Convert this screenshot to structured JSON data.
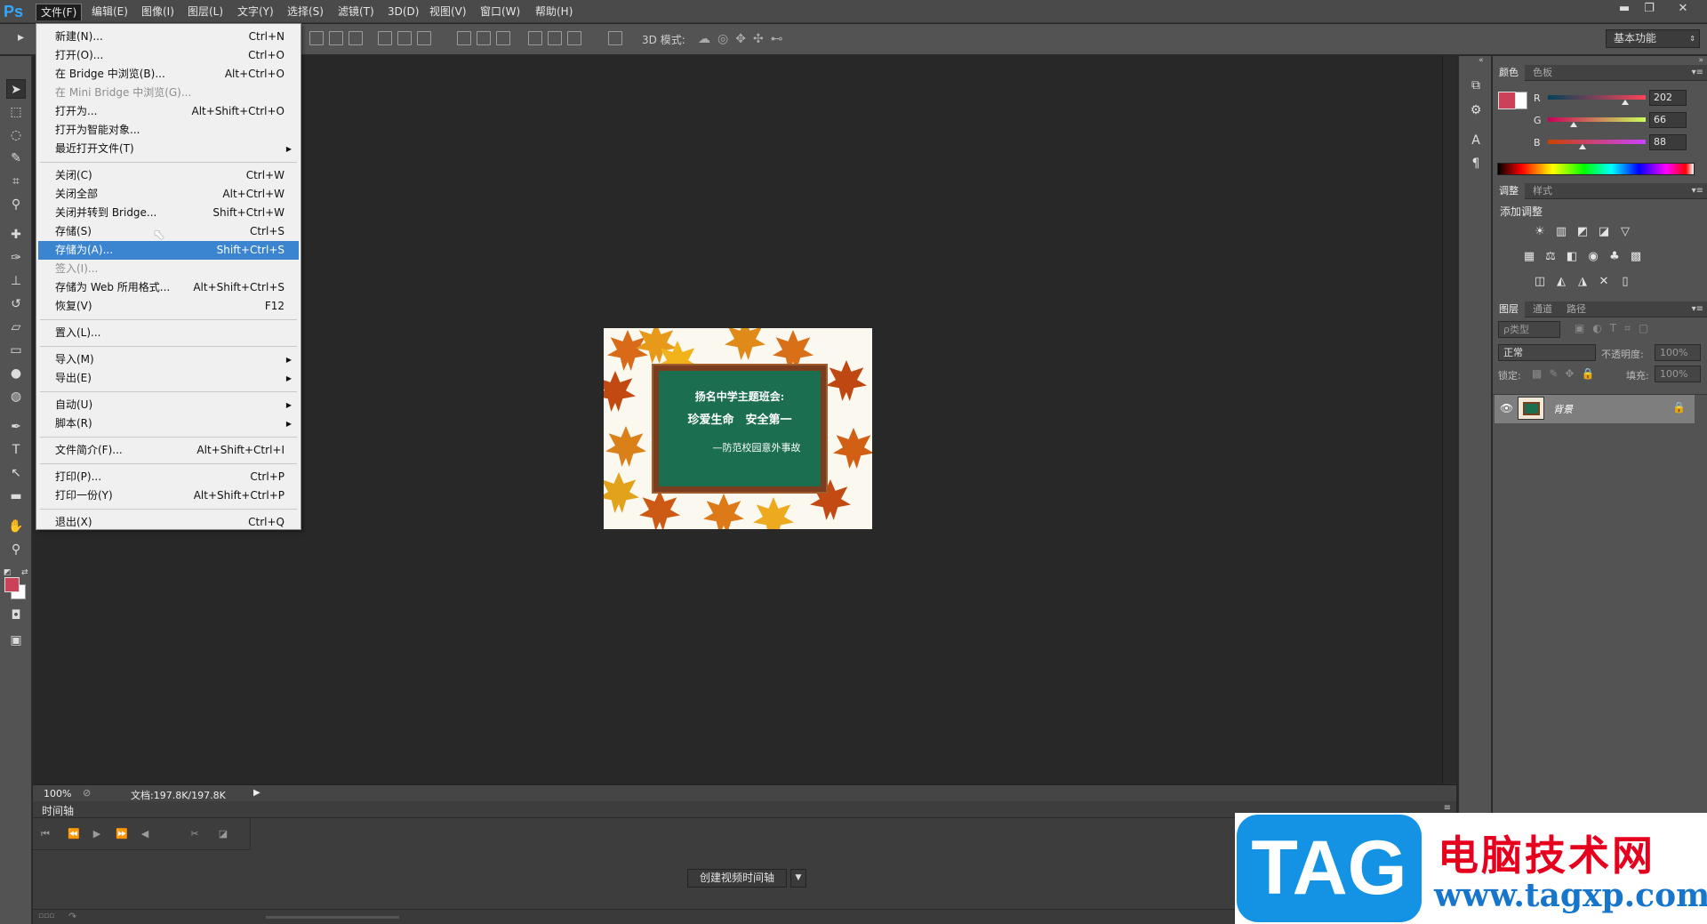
{
  "app": {
    "logo": "Ps",
    "workspace": "基本功能"
  },
  "menubar": [
    "文件(F)",
    "编辑(E)",
    "图像(I)",
    "图层(L)",
    "文字(Y)",
    "选择(S)",
    "滤镜(T)",
    "3D(D)",
    "视图(V)",
    "窗口(W)",
    "帮助(H)"
  ],
  "window_controls": {
    "minimize": "▬",
    "restore": "❐",
    "close": "✕"
  },
  "options_bar": {
    "mode_label": "3D 模式:"
  },
  "file_menu": [
    {
      "label": "新建(N)...",
      "shortcut": "Ctrl+N"
    },
    {
      "label": "打开(O)...",
      "shortcut": "Ctrl+O"
    },
    {
      "label": "在 Bridge 中浏览(B)...",
      "shortcut": "Alt+Ctrl+O"
    },
    {
      "label": "在 Mini Bridge 中浏览(G)...",
      "shortcut": "",
      "disabled": true
    },
    {
      "label": "打开为...",
      "shortcut": "Alt+Shift+Ctrl+O"
    },
    {
      "label": "打开为智能对象...",
      "shortcut": ""
    },
    {
      "label": "最近打开文件(T)",
      "shortcut": "",
      "submenu": true
    },
    {
      "label": "关闭(C)",
      "shortcut": "Ctrl+W"
    },
    {
      "label": "关闭全部",
      "shortcut": "Alt+Ctrl+W"
    },
    {
      "label": "关闭并转到 Bridge...",
      "shortcut": "Shift+Ctrl+W"
    },
    {
      "label": "存储(S)",
      "shortcut": "Ctrl+S"
    },
    {
      "label": "存储为(A)...",
      "shortcut": "Shift+Ctrl+S",
      "highlighted": true
    },
    {
      "label": "签入(I)...",
      "shortcut": "",
      "disabled": true
    },
    {
      "label": "存储为 Web 所用格式...",
      "shortcut": "Alt+Shift+Ctrl+S"
    },
    {
      "label": "恢复(V)",
      "shortcut": "F12"
    },
    {
      "label": "置入(L)...",
      "shortcut": ""
    },
    {
      "label": "导入(M)",
      "shortcut": "",
      "submenu": true
    },
    {
      "label": "导出(E)",
      "shortcut": "",
      "submenu": true
    },
    {
      "label": "自动(U)",
      "shortcut": "",
      "submenu": true
    },
    {
      "label": "脚本(R)",
      "shortcut": "",
      "submenu": true
    },
    {
      "label": "文件简介(F)...",
      "shortcut": "Alt+Shift+Ctrl+I"
    },
    {
      "label": "打印(P)...",
      "shortcut": "Ctrl+P"
    },
    {
      "label": "打印一份(Y)",
      "shortcut": "Alt+Shift+Ctrl+P"
    },
    {
      "label": "退出(X)",
      "shortcut": "Ctrl+Q"
    }
  ],
  "document": {
    "line1": "扬名中学主题班会:",
    "line2": "珍爱生命　安全第一",
    "line3": "—防范校园意外事故"
  },
  "status": {
    "zoom": "100%",
    "doc_info": "文档:197.8K/197.8K"
  },
  "timeline": {
    "tab": "时间轴",
    "create_button": "创建视频时间轴"
  },
  "color_panel": {
    "tabs": [
      "颜色",
      "色板"
    ],
    "fg_color": "#ca4258",
    "bg_color": "#ffffff",
    "channels": [
      {
        "label": "R",
        "value": "202",
        "pct": 0.79
      },
      {
        "label": "G",
        "value": "66",
        "pct": 0.26
      },
      {
        "label": "B",
        "value": "88",
        "pct": 0.35
      }
    ]
  },
  "adjust_panel": {
    "tabs": [
      "调整",
      "样式"
    ],
    "title": "添加调整"
  },
  "layers_panel": {
    "tabs": [
      "图层",
      "通道",
      "路径"
    ],
    "filter": "ρ类型",
    "blend_mode": "正常",
    "opacity_label": "不透明度:",
    "opacity_value": "100%",
    "lock_label": "锁定:",
    "fill_label": "填充:",
    "fill_value": "100%",
    "layers": [
      {
        "name": "背景",
        "visible": true,
        "locked": true
      }
    ]
  },
  "watermark": {
    "tag": "TAG",
    "title": "电脑技术网",
    "url": "www.tagxp.com"
  }
}
